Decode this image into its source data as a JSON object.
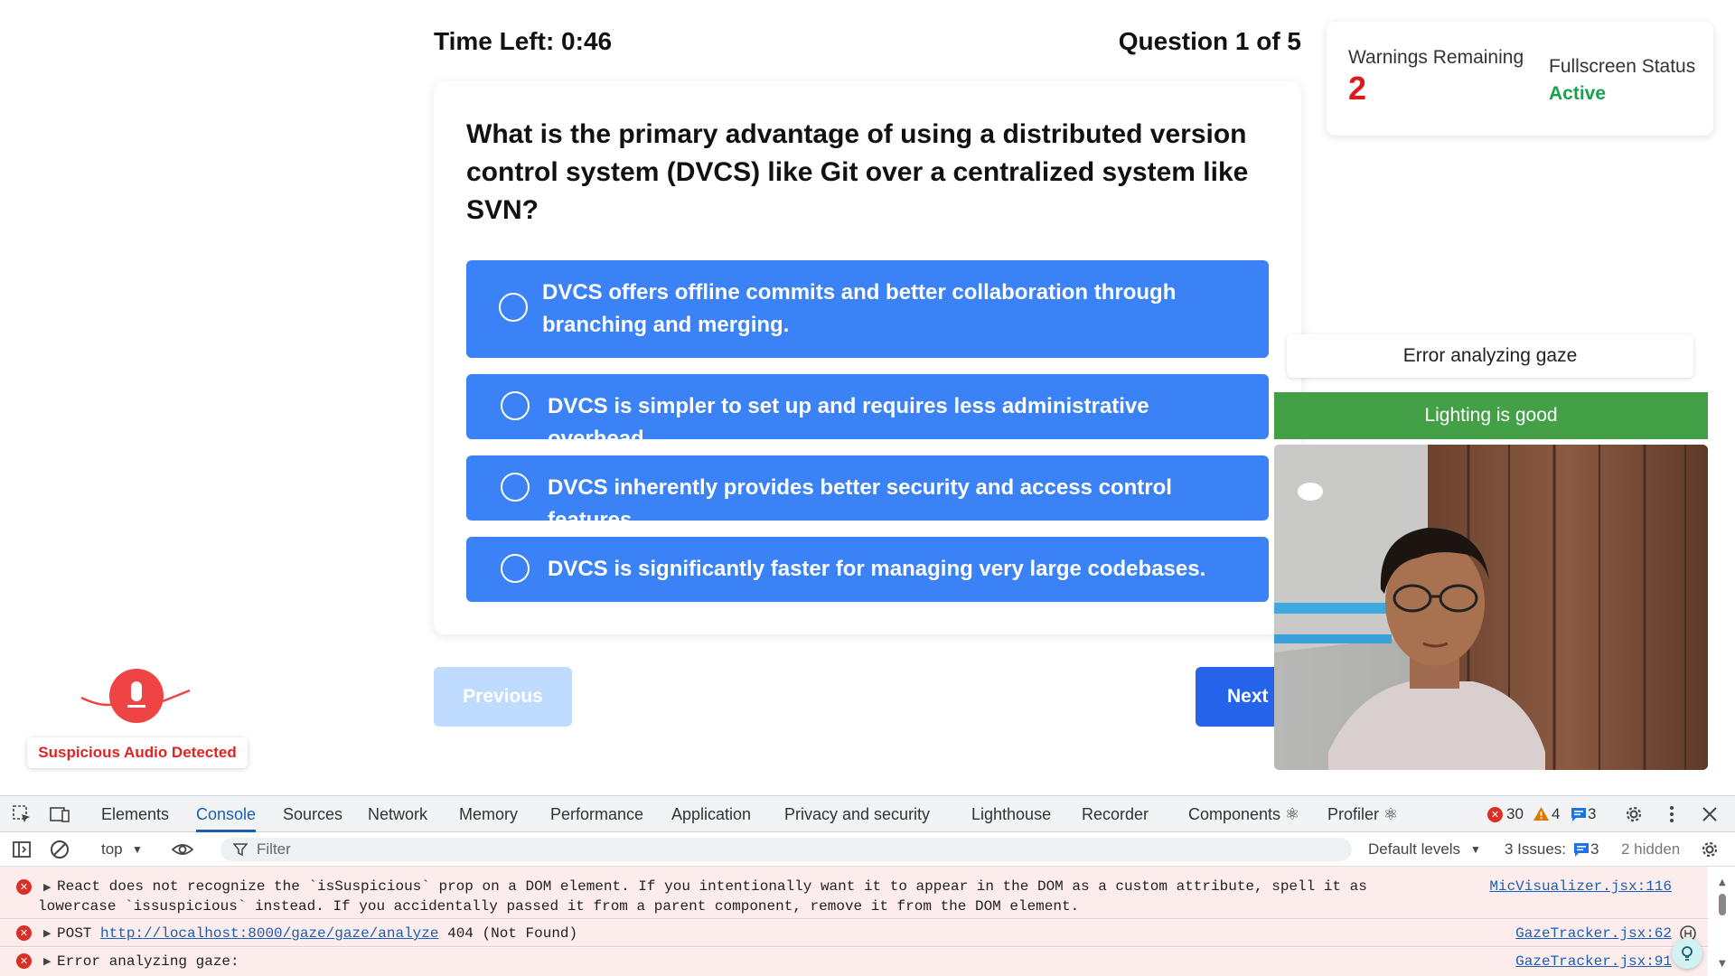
{
  "quiz": {
    "timer": "Time Left: 0:46",
    "counter": "Question 1 of 5",
    "question": "What is the primary advantage of using a distributed version control system (DVCS) like Git over a centralized system like SVN?",
    "options": [
      "DVCS offers offline commits and better collaboration through branching and merging.",
      "DVCS is simpler to set up and requires less administrative overhead.",
      "DVCS inherently provides better security and access control features.",
      "DVCS is significantly faster for managing very large codebases."
    ],
    "previous_label": "Previous",
    "next_label": "Next"
  },
  "status": {
    "warnings_label": "Warnings Remaining",
    "warnings_value": "2",
    "fullscreen_label": "Fullscreen Status",
    "fullscreen_value": "Active"
  },
  "proctor": {
    "gaze_message": "Error analyzing gaze",
    "lighting": "Lighting is good",
    "audio_alert": "Suspicious Audio Detected"
  },
  "devtools": {
    "tabs": [
      "Elements",
      "Console",
      "Sources",
      "Network",
      "Memory",
      "Performance",
      "Application",
      "Privacy and security",
      "Lighthouse",
      "Recorder",
      "Components ⚛",
      "Profiler ⚛"
    ],
    "error_count": "30",
    "warning_count": "4",
    "info_count": "3",
    "context": "top",
    "filter_placeholder": "Filter",
    "levels": "Default levels",
    "issues_label": "3 Issues:",
    "issues_count": "3",
    "hidden": "2 hidden",
    "logs": [
      {
        "line1": "React does not recognize the `isSuspicious` prop on a DOM element. If you intentionally want it to appear in the DOM as a custom attribute, spell it as",
        "line2": "lowercase `issuspicious` instead. If you accidentally passed it from a parent component, remove it from the DOM element.",
        "source": "MicVisualizer.jsx:116"
      },
      {
        "method": "POST",
        "url": "http://localhost:8000/gaze/gaze/analyze",
        "status": "404 (Not Found)",
        "source": "GazeTracker.jsx:62"
      },
      {
        "line1": "Error analyzing gaze:",
        "source": "GazeTracker.jsx:91"
      }
    ]
  },
  "colors": {
    "accent": "#3b82f6",
    "next_button": "#2563eb",
    "warning_red": "#dc1a1a",
    "active_green": "#16a34a",
    "lighting_green": "#43a047"
  }
}
